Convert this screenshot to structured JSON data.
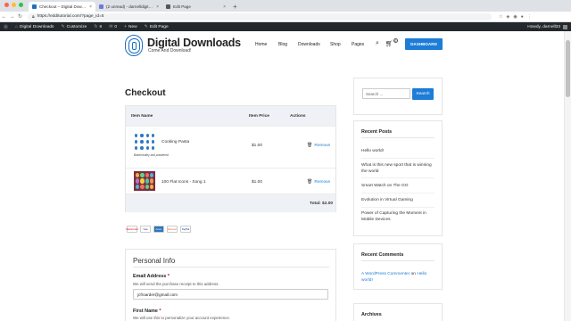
{
  "browser": {
    "tabs": [
      {
        "label": "Checkout – Digital Downloads",
        "active": true
      },
      {
        "label": "(2 unread) - darnelldigitaldow...",
        "active": false
      },
      {
        "label": "Edit Page",
        "active": false
      }
    ],
    "new_tab": "+",
    "url": "https://edditutorial.com/?page_id=5"
  },
  "wp_admin_bar": {
    "site": "Digital Downloads",
    "customize": "Customize",
    "updates": "6",
    "comments": "0",
    "new": "New",
    "edit_page": "Edit Page",
    "howdy": "Howdy, darnell33"
  },
  "header": {
    "site_title": "Digital Downloads",
    "tagline": "Come And Download!",
    "nav": [
      "Home",
      "Blog",
      "Downloads",
      "Shop",
      "Pages"
    ],
    "cart_count": "0",
    "dashboard_button": "DASHBOARD"
  },
  "checkout": {
    "title": "Checkout",
    "columns": {
      "name": "Item Name",
      "price": "Item Price",
      "actions": "Actions"
    },
    "items": [
      {
        "name": "Cooking Pasta",
        "price": "$1.00",
        "action": "Remove",
        "caption": "Bakemeathy and powdered"
      },
      {
        "name": "100 Flat Icons - Song 1",
        "price": "$1.00",
        "action": "Remove"
      }
    ],
    "total": "Total: $2.00",
    "payment_methods": [
      "MasterCard",
      "Visa",
      "Amex",
      "Discover",
      "PayPal"
    ]
  },
  "personal_info": {
    "title": "Personal Info",
    "email_label": "Email Address",
    "required_mark": "*",
    "email_hint": "We will send the purchase receipt to this address.",
    "email_value": "jcfroarder@gmail.com",
    "first_name_label": "First Name",
    "first_name_hint": "We will use this to personalize your account experience."
  },
  "sidebar": {
    "search_placeholder": "Search ...",
    "search_button": "Search",
    "recent_posts_title": "Recent Posts",
    "recent_posts": [
      "Hello world!",
      "What is this new sport that is winning the world",
      "Smart Watch on The GO",
      "Evolution in Virtual Gaming",
      "Power of Capturing the Moment in Mobile Devices"
    ],
    "recent_comments_title": "Recent Comments",
    "comment_author": "A WordPress Commenter",
    "comment_on": "on",
    "comment_post": "Hello world!",
    "archives_title": "Archives"
  },
  "colors": {
    "accent": "#1c7cd6",
    "admin_bar": "#23282d",
    "table_header": "#eef2f7"
  }
}
